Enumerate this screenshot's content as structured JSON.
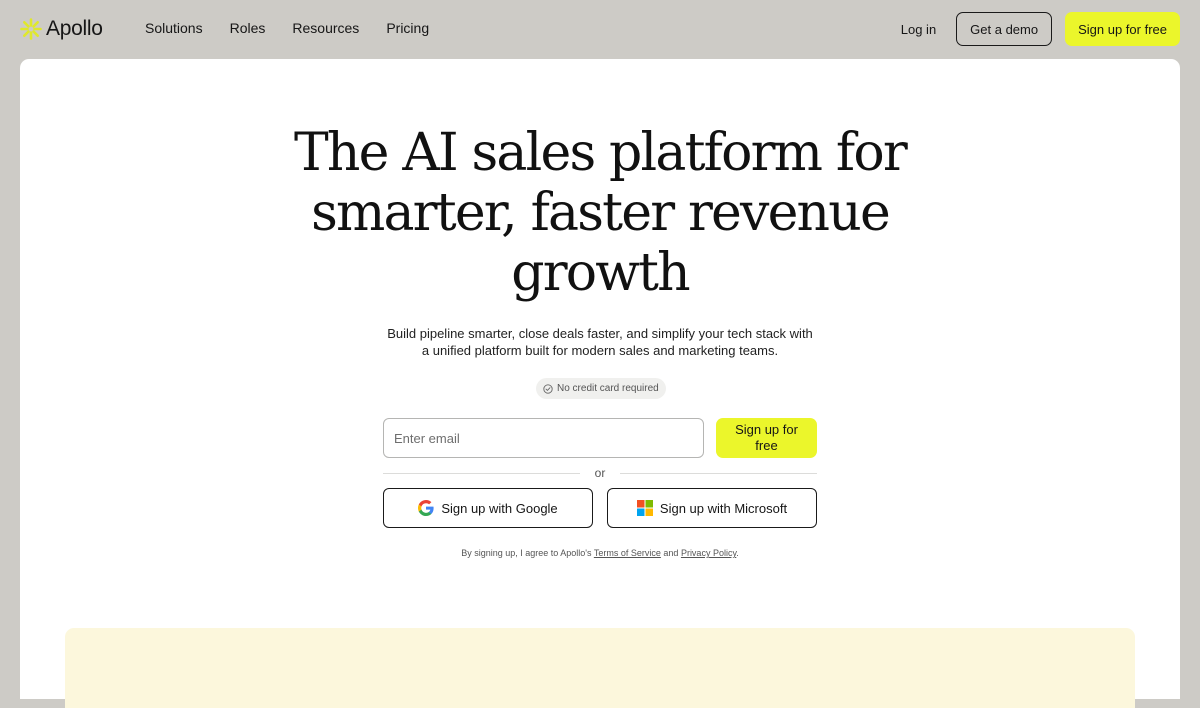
{
  "brand": {
    "name": "Apollo",
    "logo_icon": "apollo-asterisk-icon",
    "accent_color": "#ebf62b"
  },
  "nav": {
    "links": [
      "Solutions",
      "Roles",
      "Resources",
      "Pricing"
    ],
    "login_label": "Log in",
    "demo_label": "Get a demo",
    "signup_label": "Sign up for free"
  },
  "hero": {
    "title_lines": [
      "The AI sales platform for",
      "smarter, faster revenue",
      "growth"
    ],
    "subtitle_lines": [
      "Build pipeline smarter, close deals faster, and simplify your tech stack with",
      "a unified platform built for modern sales and marketing teams."
    ],
    "badge": "No credit card required",
    "badge_icon": "check-circle-icon"
  },
  "signup_form": {
    "email_placeholder": "Enter email",
    "submit_label": "Sign up for free",
    "divider": "or",
    "google_label": "Sign up with Google",
    "google_icon": "google-icon",
    "microsoft_label": "Sign up with Microsoft",
    "microsoft_icon": "microsoft-icon"
  },
  "legal": {
    "prefix": "By signing up, I agree to Apollo's",
    "terms": "Terms of Service",
    "and": "and",
    "privacy": "Privacy Policy",
    "suffix": "."
  }
}
